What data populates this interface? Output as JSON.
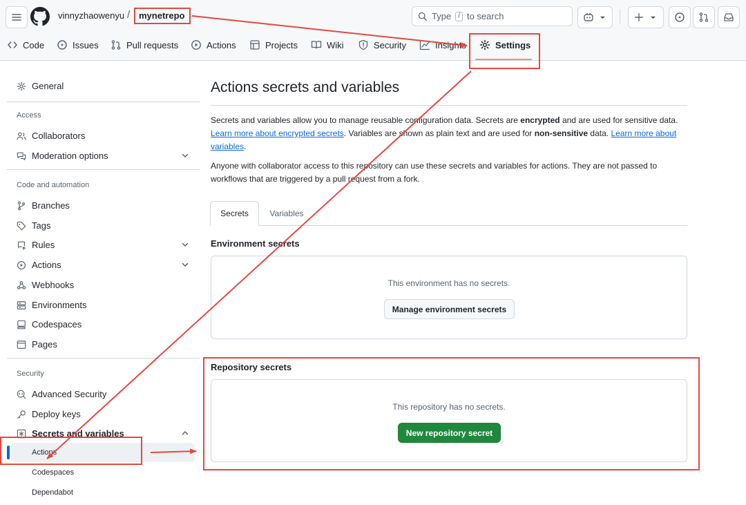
{
  "header": {
    "owner": "vinnyzhaowenyu",
    "separator": "/",
    "repo": "mynetrepo",
    "search_type": "Type",
    "search_key": "/",
    "search_rest": "to search"
  },
  "repo_nav": [
    {
      "label": "Code",
      "icon": "code-icon"
    },
    {
      "label": "Issues",
      "icon": "issue-icon"
    },
    {
      "label": "Pull requests",
      "icon": "pull-request-icon"
    },
    {
      "label": "Actions",
      "icon": "play-icon"
    },
    {
      "label": "Projects",
      "icon": "table-icon"
    },
    {
      "label": "Wiki",
      "icon": "book-icon"
    },
    {
      "label": "Security",
      "icon": "shield-icon"
    },
    {
      "label": "Insights",
      "icon": "graph-icon"
    },
    {
      "label": "Settings",
      "icon": "gear-icon"
    }
  ],
  "sidebar": {
    "general": "General",
    "access_heading": "Access",
    "collaborators": "Collaborators",
    "moderation": "Moderation options",
    "code_heading": "Code and automation",
    "branches": "Branches",
    "tags": "Tags",
    "rules": "Rules",
    "actions": "Actions",
    "webhooks": "Webhooks",
    "environments": "Environments",
    "codespaces": "Codespaces",
    "pages": "Pages",
    "security_heading": "Security",
    "advanced_security": "Advanced Security",
    "deploy_keys": "Deploy keys",
    "secrets_variables": "Secrets and variables",
    "sub_actions": "Actions",
    "sub_codespaces": "Codespaces",
    "sub_dependabot": "Dependabot"
  },
  "main": {
    "title": "Actions secrets and variables",
    "p1_a": "Secrets and variables allow you to manage reusable configuration data. Secrets are ",
    "p1_b": "encrypted",
    "p1_c": " and are used for sensitive data. ",
    "p1_link1": "Learn more about encrypted secrets",
    "p1_d": ". Variables are shown as plain text and are used for ",
    "p1_e": "non-sensitive",
    "p1_f": " data. ",
    "p1_link2": "Learn more about variables",
    "p1_g": ".",
    "p2": "Anyone with collaborator access to this repository can use these secrets and variables for actions. They are not passed to workflows that are triggered by a pull request from a fork.",
    "tab_secrets": "Secrets",
    "tab_variables": "Variables",
    "env_heading": "Environment secrets",
    "env_empty": "This environment has no secrets.",
    "env_button": "Manage environment secrets",
    "repo_heading": "Repository secrets",
    "repo_empty": "This repository has no secrets.",
    "repo_button": "New repository secret"
  },
  "colors": {
    "annotation": "#e5473f",
    "primary_button": "#1f883d",
    "link": "#0969da",
    "active_indicator": "#0969da"
  }
}
